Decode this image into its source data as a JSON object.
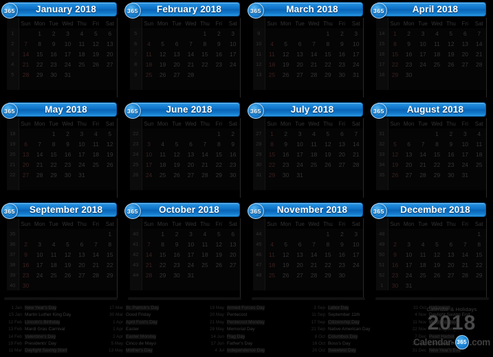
{
  "brand": {
    "badge_text": "365",
    "logo_tagline": "Calendar & Holidays",
    "logo_year": "2018",
    "logo_name_left": "Calendar-",
    "logo_name_right": ".com",
    "accent_color": "#0c6fc4",
    "badge_color": "#1e86d6",
    "background_color": "#000000"
  },
  "weekday_headers": [
    "Sun",
    "Mon",
    "Tue",
    "Wed",
    "Thu",
    "Fri",
    "Sat"
  ],
  "week_column_header": "",
  "months": [
    {
      "title": "January 2018",
      "weeks": [
        {
          "wk": "1",
          "days": [
            "",
            "1",
            "2",
            "3",
            "4",
            "5",
            "6"
          ]
        },
        {
          "wk": "2",
          "days": [
            "7",
            "8",
            "9",
            "10",
            "11",
            "12",
            "13"
          ]
        },
        {
          "wk": "3",
          "days": [
            "14",
            "15",
            "16",
            "17",
            "18",
            "19",
            "20"
          ]
        },
        {
          "wk": "4",
          "days": [
            "21",
            "22",
            "23",
            "24",
            "25",
            "26",
            "27"
          ]
        },
        {
          "wk": "5",
          "days": [
            "28",
            "29",
            "30",
            "31",
            "",
            "",
            ""
          ]
        },
        {
          "wk": "",
          "days": [
            "",
            "",
            "",
            "",
            "",
            "",
            ""
          ]
        }
      ]
    },
    {
      "title": "February 2018",
      "weeks": [
        {
          "wk": "5",
          "days": [
            "",
            "",
            "",
            "",
            "1",
            "2",
            "3"
          ]
        },
        {
          "wk": "6",
          "days": [
            "4",
            "5",
            "6",
            "7",
            "8",
            "9",
            "10"
          ]
        },
        {
          "wk": "7",
          "days": [
            "11",
            "12",
            "13",
            "14",
            "15",
            "16",
            "17"
          ]
        },
        {
          "wk": "8",
          "days": [
            "18",
            "19",
            "20",
            "21",
            "22",
            "23",
            "24"
          ]
        },
        {
          "wk": "9",
          "days": [
            "25",
            "26",
            "27",
            "28",
            "",
            "",
            ""
          ]
        },
        {
          "wk": "",
          "days": [
            "",
            "",
            "",
            "",
            "",
            "",
            ""
          ]
        }
      ]
    },
    {
      "title": "March 2018",
      "weeks": [
        {
          "wk": "9",
          "days": [
            "",
            "",
            "",
            "",
            "1",
            "2",
            "3"
          ]
        },
        {
          "wk": "10",
          "days": [
            "4",
            "5",
            "6",
            "7",
            "8",
            "9",
            "10"
          ]
        },
        {
          "wk": "11",
          "days": [
            "11",
            "12",
            "13",
            "14",
            "15",
            "16",
            "17"
          ]
        },
        {
          "wk": "12",
          "days": [
            "18",
            "19",
            "20",
            "21",
            "22",
            "23",
            "24"
          ]
        },
        {
          "wk": "13",
          "days": [
            "25",
            "26",
            "27",
            "28",
            "29",
            "30",
            "31"
          ]
        },
        {
          "wk": "",
          "days": [
            "",
            "",
            "",
            "",
            "",
            "",
            ""
          ]
        }
      ]
    },
    {
      "title": "April 2018",
      "weeks": [
        {
          "wk": "14",
          "days": [
            "1",
            "2",
            "3",
            "4",
            "5",
            "6",
            "7"
          ]
        },
        {
          "wk": "15",
          "days": [
            "8",
            "9",
            "10",
            "11",
            "12",
            "13",
            "14"
          ]
        },
        {
          "wk": "16",
          "days": [
            "15",
            "16",
            "17",
            "18",
            "19",
            "20",
            "21"
          ]
        },
        {
          "wk": "17",
          "days": [
            "22",
            "23",
            "24",
            "25",
            "26",
            "27",
            "28"
          ]
        },
        {
          "wk": "18",
          "days": [
            "29",
            "30",
            "",
            "",
            "",
            "",
            ""
          ]
        },
        {
          "wk": "",
          "days": [
            "",
            "",
            "",
            "",
            "",
            "",
            ""
          ]
        }
      ]
    },
    {
      "title": "May 2018",
      "weeks": [
        {
          "wk": "18",
          "days": [
            "",
            "",
            "1",
            "2",
            "3",
            "4",
            "5"
          ]
        },
        {
          "wk": "19",
          "days": [
            "6",
            "7",
            "8",
            "9",
            "10",
            "11",
            "12"
          ]
        },
        {
          "wk": "20",
          "days": [
            "13",
            "14",
            "15",
            "16",
            "17",
            "18",
            "19"
          ]
        },
        {
          "wk": "21",
          "days": [
            "20",
            "21",
            "22",
            "23",
            "24",
            "25",
            "26"
          ]
        },
        {
          "wk": "22",
          "days": [
            "27",
            "28",
            "29",
            "30",
            "31",
            "",
            ""
          ]
        },
        {
          "wk": "",
          "days": [
            "",
            "",
            "",
            "",
            "",
            "",
            ""
          ]
        }
      ]
    },
    {
      "title": "June 2018",
      "weeks": [
        {
          "wk": "22",
          "days": [
            "",
            "",
            "",
            "",
            "",
            "1",
            "2"
          ]
        },
        {
          "wk": "23",
          "days": [
            "3",
            "4",
            "5",
            "6",
            "7",
            "8",
            "9"
          ]
        },
        {
          "wk": "24",
          "days": [
            "10",
            "11",
            "12",
            "13",
            "14",
            "15",
            "16"
          ]
        },
        {
          "wk": "25",
          "days": [
            "17",
            "18",
            "19",
            "20",
            "21",
            "22",
            "23"
          ]
        },
        {
          "wk": "26",
          "days": [
            "24",
            "25",
            "26",
            "27",
            "28",
            "29",
            "30"
          ]
        },
        {
          "wk": "",
          "days": [
            "",
            "",
            "",
            "",
            "",
            "",
            ""
          ]
        }
      ]
    },
    {
      "title": "July 2018",
      "weeks": [
        {
          "wk": "27",
          "days": [
            "1",
            "2",
            "3",
            "4",
            "5",
            "6",
            "7"
          ]
        },
        {
          "wk": "28",
          "days": [
            "8",
            "9",
            "10",
            "11",
            "12",
            "13",
            "14"
          ]
        },
        {
          "wk": "29",
          "days": [
            "15",
            "16",
            "17",
            "18",
            "19",
            "20",
            "21"
          ]
        },
        {
          "wk": "30",
          "days": [
            "22",
            "23",
            "24",
            "25",
            "26",
            "27",
            "28"
          ]
        },
        {
          "wk": "31",
          "days": [
            "29",
            "30",
            "31",
            "",
            "",
            "",
            ""
          ]
        },
        {
          "wk": "",
          "days": [
            "",
            "",
            "",
            "",
            "",
            "",
            ""
          ]
        }
      ]
    },
    {
      "title": "August 2018",
      "weeks": [
        {
          "wk": "31",
          "days": [
            "",
            "",
            "",
            "1",
            "2",
            "3",
            "4"
          ]
        },
        {
          "wk": "32",
          "days": [
            "5",
            "6",
            "7",
            "8",
            "9",
            "10",
            "11"
          ]
        },
        {
          "wk": "33",
          "days": [
            "12",
            "13",
            "14",
            "15",
            "16",
            "17",
            "18"
          ]
        },
        {
          "wk": "34",
          "days": [
            "19",
            "20",
            "21",
            "22",
            "23",
            "24",
            "25"
          ]
        },
        {
          "wk": "35",
          "days": [
            "26",
            "27",
            "28",
            "29",
            "30",
            "31",
            ""
          ]
        },
        {
          "wk": "",
          "days": [
            "",
            "",
            "",
            "",
            "",
            "",
            ""
          ]
        }
      ]
    },
    {
      "title": "September 2018",
      "weeks": [
        {
          "wk": "35",
          "days": [
            "",
            "",
            "",
            "",
            "",
            "",
            "1"
          ]
        },
        {
          "wk": "36",
          "days": [
            "2",
            "3",
            "4",
            "5",
            "6",
            "7",
            "8"
          ]
        },
        {
          "wk": "37",
          "days": [
            "9",
            "10",
            "11",
            "12",
            "13",
            "14",
            "15"
          ]
        },
        {
          "wk": "38",
          "days": [
            "16",
            "17",
            "18",
            "19",
            "20",
            "21",
            "22"
          ]
        },
        {
          "wk": "39",
          "days": [
            "23",
            "24",
            "25",
            "26",
            "27",
            "28",
            "29"
          ]
        },
        {
          "wk": "40",
          "days": [
            "30",
            "",
            "",
            "",
            "",
            "",
            ""
          ]
        }
      ]
    },
    {
      "title": "October 2018",
      "weeks": [
        {
          "wk": "40",
          "days": [
            "",
            "1",
            "2",
            "3",
            "4",
            "5",
            "6"
          ]
        },
        {
          "wk": "41",
          "days": [
            "7",
            "8",
            "9",
            "10",
            "11",
            "12",
            "13"
          ]
        },
        {
          "wk": "42",
          "days": [
            "14",
            "15",
            "16",
            "17",
            "18",
            "19",
            "20"
          ]
        },
        {
          "wk": "43",
          "days": [
            "21",
            "22",
            "23",
            "24",
            "25",
            "26",
            "27"
          ]
        },
        {
          "wk": "44",
          "days": [
            "28",
            "29",
            "30",
            "31",
            "",
            "",
            ""
          ]
        },
        {
          "wk": "",
          "days": [
            "",
            "",
            "",
            "",
            "",
            "",
            ""
          ]
        }
      ]
    },
    {
      "title": "November 2018",
      "weeks": [
        {
          "wk": "44",
          "days": [
            "",
            "",
            "",
            "",
            "1",
            "2",
            "3"
          ]
        },
        {
          "wk": "45",
          "days": [
            "4",
            "5",
            "6",
            "7",
            "8",
            "9",
            "10"
          ]
        },
        {
          "wk": "46",
          "days": [
            "11",
            "12",
            "13",
            "14",
            "15",
            "16",
            "17"
          ]
        },
        {
          "wk": "47",
          "days": [
            "18",
            "19",
            "20",
            "21",
            "22",
            "23",
            "24"
          ]
        },
        {
          "wk": "48",
          "days": [
            "25",
            "26",
            "27",
            "28",
            "29",
            "30",
            ""
          ]
        },
        {
          "wk": "",
          "days": [
            "",
            "",
            "",
            "",
            "",
            "",
            ""
          ]
        }
      ]
    },
    {
      "title": "December 2018",
      "weeks": [
        {
          "wk": "48",
          "days": [
            "",
            "",
            "",
            "",
            "",
            "",
            "1"
          ]
        },
        {
          "wk": "49",
          "days": [
            "2",
            "3",
            "4",
            "5",
            "6",
            "7",
            "8"
          ]
        },
        {
          "wk": "50",
          "days": [
            "9",
            "10",
            "11",
            "12",
            "13",
            "14",
            "15"
          ]
        },
        {
          "wk": "51",
          "days": [
            "16",
            "17",
            "18",
            "19",
            "20",
            "21",
            "22"
          ]
        },
        {
          "wk": "52",
          "days": [
            "23",
            "24",
            "25",
            "26",
            "27",
            "28",
            "29"
          ]
        },
        {
          "wk": "1",
          "days": [
            "30",
            "31",
            "",
            "",
            "",
            "",
            ""
          ]
        }
      ]
    }
  ],
  "legend_columns": [
    [
      {
        "date": "1 Jan",
        "name": "New Year's Day"
      },
      {
        "date": "15 Jan",
        "name": "Martin Luther King Day"
      },
      {
        "date": "12 Feb",
        "name": "Lincoln's Birthday"
      },
      {
        "date": "13 Feb",
        "name": "Mardi Gras Carnival"
      },
      {
        "date": "14 Feb",
        "name": "Valentine's Day"
      },
      {
        "date": "19 Feb",
        "name": "Presidents' Day"
      },
      {
        "date": "11 Mar",
        "name": "Daylight Saving Start"
      }
    ],
    [
      {
        "date": "17 Mar",
        "name": "St. Patrick's Day"
      },
      {
        "date": "30 Mar",
        "name": "Good Friday"
      },
      {
        "date": "1 Apr",
        "name": "April Fool's Day"
      },
      {
        "date": "1 Apr",
        "name": "Easter"
      },
      {
        "date": "2 Apr",
        "name": "Easter Monday"
      },
      {
        "date": "5 May",
        "name": "Cinco de Mayo"
      },
      {
        "date": "13 May",
        "name": "Mother's Day"
      }
    ],
    [
      {
        "date": "19 May",
        "name": "Armed Forces Day"
      },
      {
        "date": "20 May",
        "name": "Pentecost"
      },
      {
        "date": "21 May",
        "name": "Pentecost Monday"
      },
      {
        "date": "28 May",
        "name": "Memorial Day"
      },
      {
        "date": "14 Jun",
        "name": "Flag Day"
      },
      {
        "date": "17 Jun",
        "name": "Father's Day"
      },
      {
        "date": "4 Jul",
        "name": "Independence Day"
      }
    ],
    [
      {
        "date": "3 Sep",
        "name": "Labor Day"
      },
      {
        "date": "11 Sep",
        "name": "September 11th"
      },
      {
        "date": "17 Sep",
        "name": "Citizenship Day"
      },
      {
        "date": "21 Sep",
        "name": "Native American Day"
      },
      {
        "date": "8 Oct",
        "name": "Columbus Day"
      },
      {
        "date": "16 Oct",
        "name": "Boss's Day"
      },
      {
        "date": "20 Oct",
        "name": "Sweetest Day"
      }
    ],
    [
      {
        "date": "31 Oct",
        "name": "Halloween"
      },
      {
        "date": "4 Nov",
        "name": "Daylight Saving End"
      },
      {
        "date": "11 Nov",
        "name": "Veterans Day"
      },
      {
        "date": "22 Nov",
        "name": "Thanksgiving"
      },
      {
        "date": "7 Dec",
        "name": "Pearl Harbor"
      },
      {
        "date": "25 Dec",
        "name": "Christmas Day"
      },
      {
        "date": "31 Dec",
        "name": "New Year's Eve"
      }
    ]
  ]
}
